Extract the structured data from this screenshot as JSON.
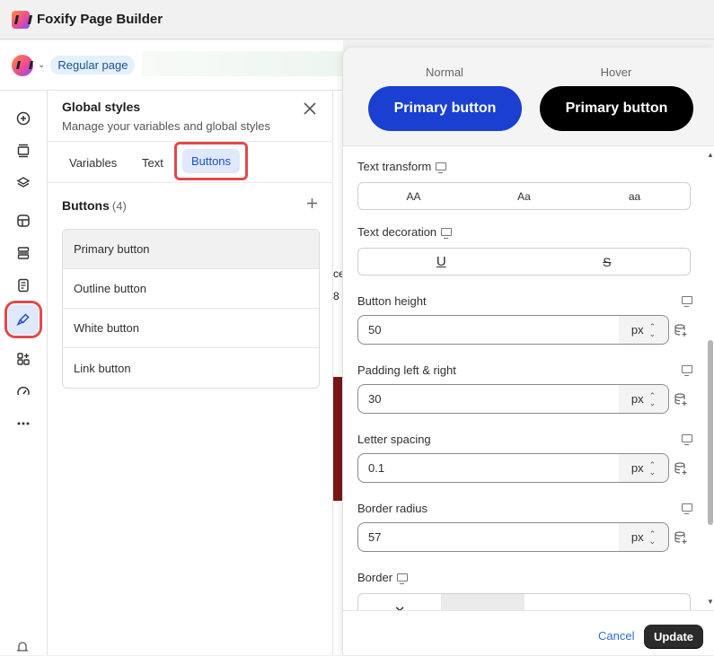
{
  "app": {
    "title": "Foxify Page Builder"
  },
  "topbar": {
    "page_badge": "Regular page"
  },
  "rail": {
    "items": [
      "add",
      "section",
      "layers",
      "template",
      "layout",
      "page",
      "styles",
      "apps",
      "speed",
      "more"
    ]
  },
  "global_styles": {
    "title": "Global styles",
    "subtitle": "Manage your variables and global styles",
    "tabs": {
      "variables": "Variables",
      "text": "Text",
      "buttons": "Buttons"
    },
    "list_title": "Buttons",
    "list_count": "(4)",
    "items": [
      "Primary button",
      "Outline button",
      "White button",
      "Link button"
    ]
  },
  "canvas": {
    "frag1": "ce",
    "frag2": "8"
  },
  "editor": {
    "preview": {
      "normal_label": "Normal",
      "hover_label": "Hover",
      "normal_button": "Primary button",
      "hover_button": "Primary button",
      "normal_color": "#1a3fd1",
      "hover_color": "#000000"
    },
    "text_transform": {
      "label": "Text transform",
      "options": [
        "AA",
        "Aa",
        "aa"
      ]
    },
    "text_decoration": {
      "label": "Text decoration",
      "options": [
        "U",
        "S"
      ]
    },
    "button_height": {
      "label": "Button height",
      "value": "50",
      "unit": "px"
    },
    "padding": {
      "label": "Padding left & right",
      "value": "30",
      "unit": "px"
    },
    "letter_spacing": {
      "label": "Letter spacing",
      "value": "0.1",
      "unit": "px"
    },
    "border_radius": {
      "label": "Border radius",
      "value": "57",
      "unit": "px"
    },
    "border": {
      "label": "Border",
      "options": [
        "✕",
        "—",
        "- - -",
        "· · · ·"
      ]
    }
  },
  "footer": {
    "cancel": "Cancel",
    "update": "Update"
  }
}
